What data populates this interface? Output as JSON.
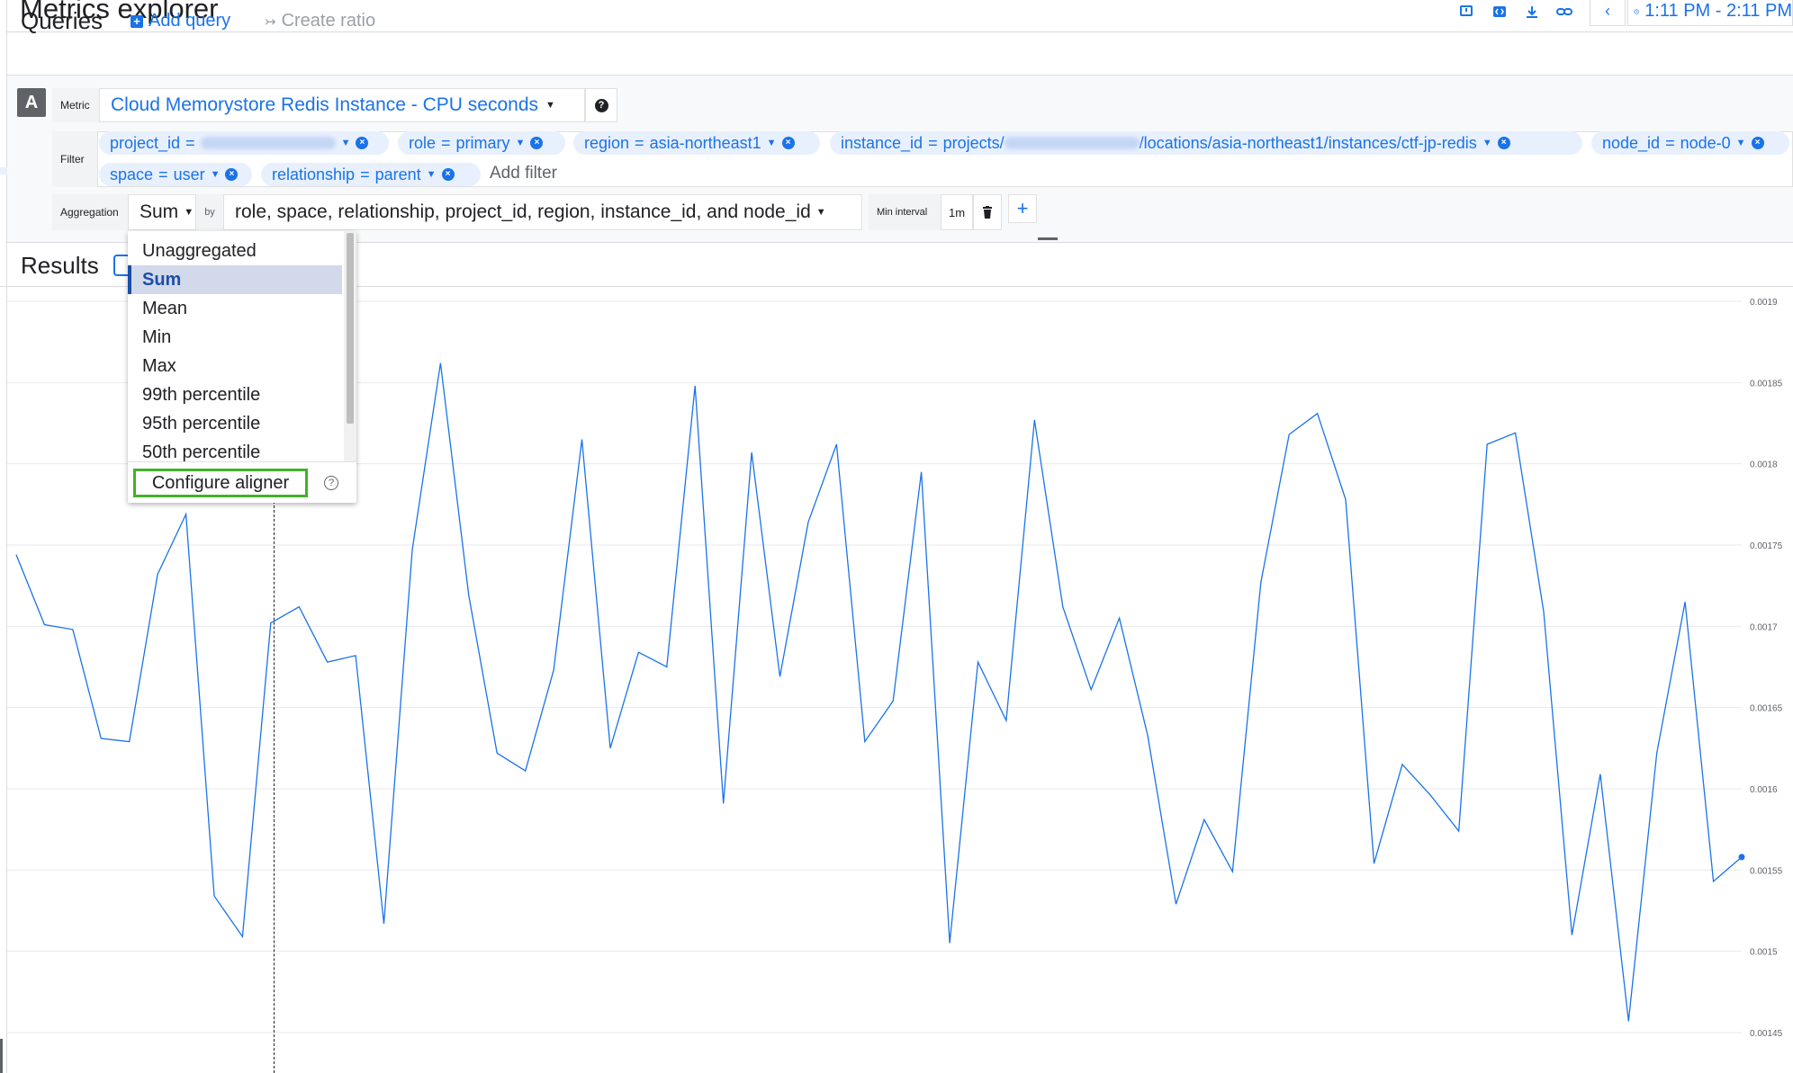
{
  "header": {
    "title": "Metrics explorer",
    "time_range": "1:11 PM - 2:11 PM",
    "icons": [
      "feedback-icon",
      "code-icon",
      "download-icon",
      "link-icon",
      "chevron-left-icon",
      "clock-icon"
    ]
  },
  "queries": {
    "title": "Queries",
    "add_query": "Add query",
    "create_ratio": "Create ratio"
  },
  "query": {
    "letter": "A",
    "metric_label": "Metric",
    "metric_value": "Cloud Memorystore Redis Instance - CPU seconds",
    "filter_label": "Filter",
    "filters": [
      {
        "key": "project_id",
        "op": "="
      },
      {
        "key": "role",
        "op": "=",
        "value": "primary"
      },
      {
        "key": "region",
        "op": "=",
        "value": "asia-northeast1"
      },
      {
        "key": "instance_id",
        "op": "=",
        "value_prefix": "projects/",
        "value_suffix": "/locations/asia-northeast1/instances/ctf-jp-redis"
      },
      {
        "key": "node_id",
        "op": "=",
        "value": "node-0"
      },
      {
        "key": "space",
        "op": "=",
        "value": "user"
      },
      {
        "key": "relationship",
        "op": "=",
        "value": "parent"
      }
    ],
    "add_filter": "Add filter",
    "aggregation_label": "Aggregation",
    "aggregation_value": "Sum",
    "by_label": "by",
    "group_by": "role, space, relationship, project_id, region, instance_id, and node_id",
    "min_interval_label": "Min interval",
    "min_interval_value": "1m"
  },
  "aggregation_dropdown": {
    "items": [
      "Unaggregated",
      "Sum",
      "Mean",
      "Min",
      "Max",
      "99th percentile",
      "95th percentile",
      "50th percentile"
    ],
    "selected": "Sum",
    "configure_aligner": "Configure aligner"
  },
  "results": {
    "title": "Results"
  },
  "colors": {
    "accent": "#1a73e8",
    "highlight_box": "#43b02a",
    "series": "#1a73e8"
  },
  "chart_data": {
    "type": "line",
    "y_ticks": [
      "0.0019",
      "0.00185",
      "0.0018",
      "0.00175",
      "0.0017",
      "0.00165",
      "0.0016",
      "0.00155",
      "0.0015",
      "0.00145"
    ],
    "ylim": [
      0.00143,
      0.00194
    ],
    "grid": true,
    "series": [
      {
        "values": [
          0.001744,
          0.001701,
          0.001698,
          0.001631,
          0.001629,
          0.001732,
          0.001769,
          0.001534,
          0.001509,
          0.001702,
          0.001712,
          0.001678,
          0.001682,
          0.001517,
          0.001747,
          0.001862,
          0.001719,
          0.001622,
          0.001611,
          0.001673,
          0.001815,
          0.001625,
          0.001684,
          0.001675,
          0.001848,
          0.001591,
          0.001807,
          0.001669,
          0.001764,
          0.001812,
          0.001629,
          0.001654,
          0.001795,
          0.001505,
          0.001678,
          0.001642,
          0.001827,
          0.001712,
          0.001661,
          0.001705,
          0.001633,
          0.001529,
          0.001581,
          0.001549,
          0.001727,
          0.001818,
          0.001831,
          0.001778,
          0.001554,
          0.001615,
          0.001596,
          0.001574,
          0.001812,
          0.001819,
          0.001709,
          0.00151,
          0.001609,
          0.001457,
          0.001622,
          0.001715,
          0.001543,
          0.001558
        ]
      }
    ]
  }
}
